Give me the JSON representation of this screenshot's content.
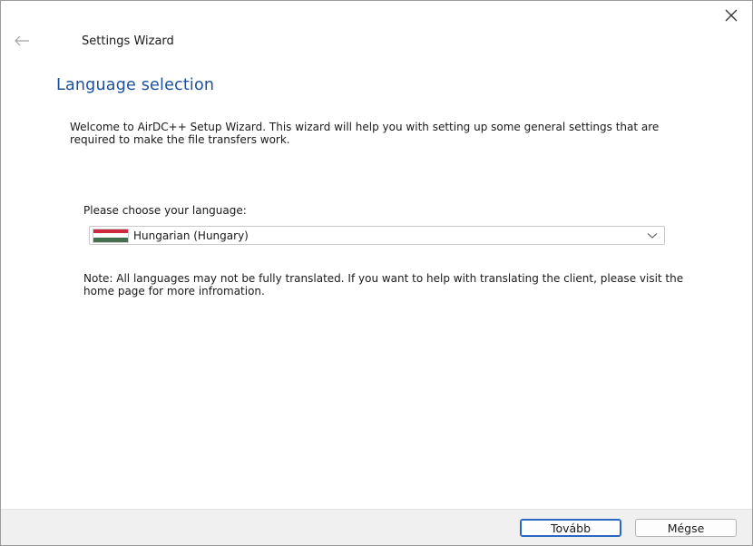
{
  "window": {
    "title": "Settings Wizard",
    "icons": {
      "back": "back-arrow-icon",
      "close": "close-icon"
    }
  },
  "page": {
    "heading": "Language selection",
    "intro": "Welcome to AirDC++ Setup Wizard. This wizard will help you with setting up some general settings that are required to make the file transfers work.",
    "language_label": "Please choose your language:",
    "note": "Note: All languages may not be fully translated. If you want to help with translating the client, please visit the home page for more infromation."
  },
  "language_select": {
    "selected": "Hungarian (Hungary)",
    "flag_colors": [
      "#cd2a3e",
      "#ffffff",
      "#436f4d"
    ],
    "icons": {
      "dropdown": "chevron-down-icon"
    }
  },
  "footer": {
    "next_label": "Tovább",
    "cancel_label": "Mégse"
  }
}
